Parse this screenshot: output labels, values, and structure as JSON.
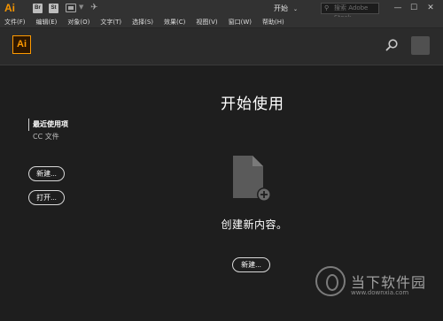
{
  "titlebar": {
    "app_logo": "Ai",
    "bridge_icon": "Br",
    "stock_icon": "St",
    "workspace_label": "开始",
    "stock_search_placeholder": "搜索 Adobe Stock",
    "minimize": "—",
    "maximize": "☐",
    "close": "✕"
  },
  "menubar": {
    "items": [
      "文件(F)",
      "编辑(E)",
      "对象(O)",
      "文字(T)",
      "选择(S)",
      "效果(C)",
      "视图(V)",
      "窗口(W)",
      "帮助(H)"
    ]
  },
  "header": {
    "logo": "Ai"
  },
  "start": {
    "title": "开始使用",
    "sidebar_items": [
      "最近使用项",
      "CC 文件"
    ],
    "new_button": "新建...",
    "open_button": "打开...",
    "empty_message": "创建新内容。",
    "main_new_button": "新建..."
  },
  "watermark": {
    "name": "当下软件园",
    "url": "www.downxia.com"
  },
  "icons": {
    "header_search": "search-icon",
    "document": "new-document-icon",
    "avatar": "user-avatar"
  },
  "colors": {
    "accent": "#ff9a00",
    "background": "#1e1e1e",
    "header": "#2b2b2b",
    "chrome": "#323232"
  }
}
